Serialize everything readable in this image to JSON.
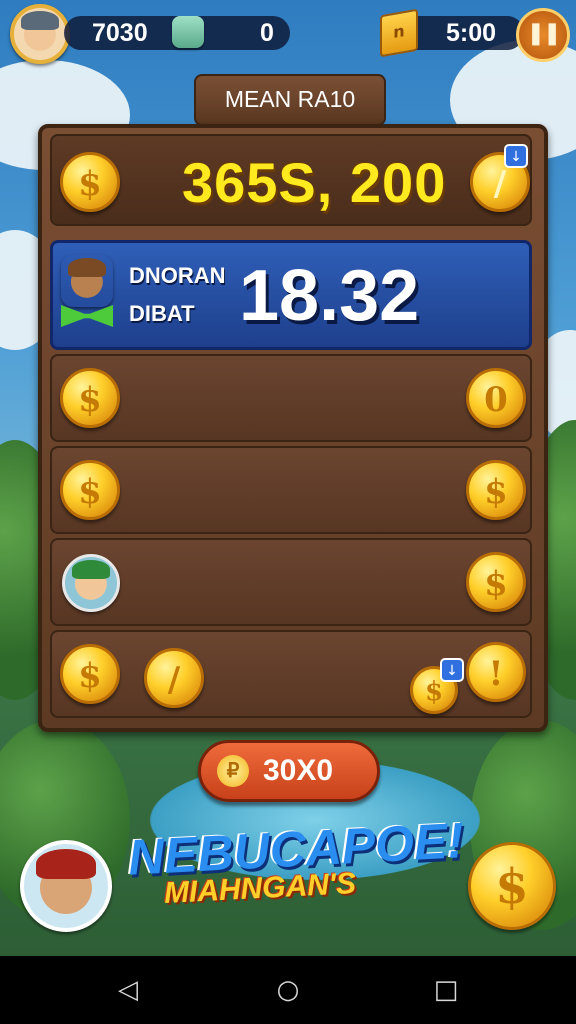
{
  "hud": {
    "player_coins": "7030",
    "gems": "0",
    "timer": "5:00",
    "gold_box_icon": "gold-box-icon",
    "pause_icon": "pause-icon"
  },
  "title": "MEAN RA10",
  "board": {
    "total": "365S, 200",
    "highlight": {
      "line1": "DNORAN",
      "line2": "DIBAT",
      "score": "18.32"
    }
  },
  "coin_symbol": "$",
  "action_button": {
    "label": "30X0",
    "icon": "coin-icon"
  },
  "promo": {
    "line1": "NEBUCAPOE!",
    "line2": "MIAHNGAN'S"
  },
  "navigation": {
    "back": "◁",
    "home": "○",
    "recents": "□"
  },
  "colors": {
    "accent": "#ffea1f",
    "board": "#5d3a24",
    "highlight": "#1e3f8c",
    "button": "#c8411a"
  }
}
